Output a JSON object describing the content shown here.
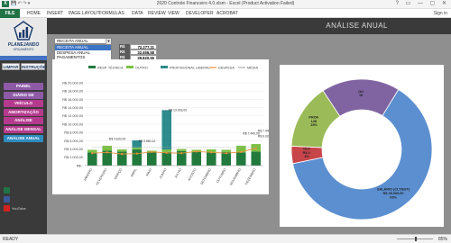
{
  "window": {
    "title": "2020 Controle Financeiro 4.0.xlsm - Excel (Product Activation Failed)",
    "controls": "? ▭ — ▢ ✕",
    "qat": "💾 ↶ ↷ ▾"
  },
  "ribbon": {
    "file": "FILE",
    "tabs": [
      "HOME",
      "INSERT",
      "PAGE LAYOUT",
      "FORMULAS",
      "DATA",
      "REVIEW",
      "VIEW",
      "DEVELOPER",
      "ACROBAT"
    ],
    "signin": "Sign in"
  },
  "brand": {
    "name": "PLANEJANDO",
    "sub": "ORÇAMENTO"
  },
  "sidebar": {
    "limpar": "LIMPAR",
    "instrucoes": "INSTRUÇÕES",
    "nav": [
      {
        "label": "PAINEL",
        "color": "#8e5aa8"
      },
      {
        "label": "DIÁRIO DE DESPESAS",
        "color": "#8e5aa8"
      },
      {
        "label": "VEÍCULO",
        "color": "#b53a8e"
      },
      {
        "label": "AMORTIZAÇÃO",
        "color": "#b53a8e"
      },
      {
        "label": "ANÁLISE CATEGORIA",
        "color": "#b53a8e"
      },
      {
        "label": "ANÁLISE MENSAL",
        "color": "#b53a8e"
      },
      {
        "label": "ANÁLISE ANUAL",
        "color": "#2e8bc0"
      }
    ],
    "icons": [
      {
        "name": "excel",
        "color": "#217346",
        "label": ""
      },
      {
        "name": "facebook",
        "color": "#3b5998",
        "label": ""
      },
      {
        "name": "youtube",
        "color": "#d32020",
        "label": "YouTube"
      }
    ]
  },
  "header": {
    "title": "ANÁLISE ANUAL"
  },
  "selector": {
    "value": "RECEITA ANUAL",
    "options": [
      "RECEITA ANUAL",
      "DESPESA ANUAL",
      "PAGAMENTOS",
      "SALDO ANUAL",
      "INVESTIMENTO ANUAL",
      "RENDA FIXA",
      "RENDA VARIÁVEL"
    ]
  },
  "kpis": [
    {
      "cur": "R$",
      "value": "72.277,11"
    },
    {
      "cur": "R$",
      "value": "32.456,58"
    },
    {
      "cur": "R$",
      "value": "39.820,55"
    }
  ],
  "chart_data": [
    {
      "type": "bar",
      "categories": [
        "JANEIRO",
        "FEVEREIRO",
        "MARÇO",
        "ABRIL",
        "MAIO",
        "JUNHO",
        "JULHO",
        "AGOSTO",
        "SETEMBRO",
        "OUTUBRO",
        "NOVEMBRO",
        "DEZEMBRO"
      ],
      "ylim": [
        0,
        20000
      ],
      "yticks": [
        "R$ -",
        "R$ 2.000,00",
        "R$ 4.000,00",
        "R$ 6.000,00",
        "R$ 8.000,00",
        "R$ 10.000,00",
        "R$ 12.000,00",
        "R$ 14.000,00",
        "R$ 16.000,00",
        "R$ 18.000,00",
        "R$ 20.000,00"
      ],
      "series": [
        {
          "name": "RESP. TÉCNICA",
          "color": "#217a3c",
          "values": [
            3200,
            3600,
            3400,
            3900,
            3300,
            3300,
            3500,
            3400,
            3200,
            3300,
            3200,
            3400
          ]
        },
        {
          "name": "OUTRO",
          "color": "#7ac142",
          "values": [
            600,
            1200,
            500,
            400,
            300,
            600,
            500,
            400,
            700,
            500,
            1600,
            1800
          ]
        },
        {
          "name": "PROFISSIONAL LIBERAL",
          "color": "#2e8b8b",
          "values": [
            0,
            0,
            0,
            1800,
            0,
            9500,
            0,
            0,
            0,
            0,
            0,
            0
          ]
        },
        {
          "name": "DESPESA",
          "color": "#e8913a",
          "values": [
            3000,
            3200,
            2800,
            2900,
            3300,
            3100,
            3000,
            3400,
            3200,
            3000,
            3300,
            4200
          ]
        },
        {
          "name": "MÉDIA",
          "color": "#aaaaaa",
          "values": [
            4400,
            4400,
            4400,
            4400,
            4400,
            4400,
            4400,
            4400,
            4400,
            4400,
            4400,
            4400
          ]
        }
      ],
      "labels": [
        {
          "text": "R$ 4.620,00",
          "cat": 1,
          "value": 6200
        },
        {
          "text": "R$ 3.960,12",
          "cat": 3,
          "value": 5700
        },
        {
          "text": "R$ 13.003,00",
          "cat": 5,
          "value": 13200
        },
        {
          "text": "R$ 7.440,00",
          "cat": 10,
          "value": 7500
        },
        {
          "text": "R$ 7.440,00",
          "cat": 11,
          "value": 8100
        },
        {
          "text": "R$ 6.026,00",
          "cat": 11,
          "value": 6900
        }
      ],
      "grid": true,
      "legend": "top"
    },
    {
      "type": "pie",
      "slices": [
        {
          "label": "SALÁRIO (CLT/EST)",
          "value_text": "R$ 45.000,00",
          "pct": "63%",
          "color": "#5b8fd0",
          "fraction": 0.63
        },
        {
          "label": "OUTRO",
          "value_text": "R$ 2.800,00",
          "pct": "4%",
          "color": "#c8454a",
          "fraction": 0.04
        },
        {
          "label": "PROF. LIBERAL",
          "value_text": "",
          "pct": "15%",
          "color": "#9bbb59",
          "fraction": 0.15
        },
        {
          "label": "OUTRO",
          "value_text": "",
          "pct": "18%",
          "color": "#8064a2",
          "fraction": 0.18
        }
      ],
      "inner_labels": [
        {
          "text": "OU\n18",
          "slice": 3
        },
        {
          "text": "PROF.\nLIB\n15%",
          "slice": 2
        },
        {
          "text": "OUT\nR$ 2.\n4%",
          "slice": 1
        },
        {
          "text": "SALÁRIO (CLT/EST)\nR$ 45.000,00\n63%",
          "slice": 0
        }
      ]
    }
  ],
  "status": {
    "ready": "READY",
    "zoom": "85%"
  }
}
